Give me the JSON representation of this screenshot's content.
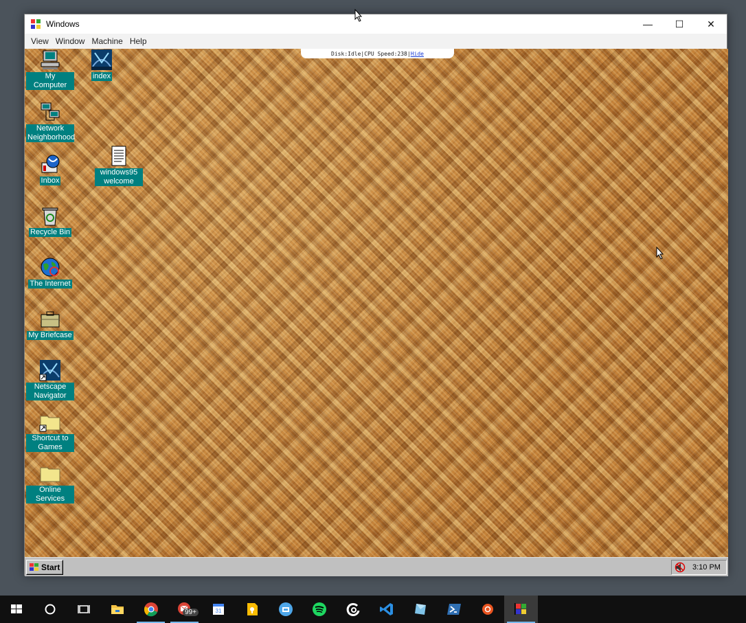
{
  "window": {
    "title": "Windows",
    "controls": {
      "minimize": "—",
      "maximize": "☐",
      "close": "✕"
    }
  },
  "menu": [
    "View",
    "Window",
    "Machine",
    "Help"
  ],
  "status": {
    "disk_label": "Disk:",
    "disk_value": "Idle",
    "separator": "|",
    "cpu_label": "CPU Speed:",
    "cpu_value": "238",
    "hide": "Hide"
  },
  "desktop_icons": [
    {
      "label": "My Computer",
      "icon": "computer-icon"
    },
    {
      "label": "index",
      "icon": "netscape-icon"
    },
    {
      "label": "Network Neighborhood",
      "icon": "network-icon"
    },
    {
      "label": "windows95 welcome",
      "icon": "text-file-icon"
    },
    {
      "label": "Inbox",
      "icon": "inbox-icon"
    },
    {
      "label": "Recycle Bin",
      "icon": "recycle-bin-icon"
    },
    {
      "label": "The Internet",
      "icon": "internet-icon"
    },
    {
      "label": "My Briefcase",
      "icon": "briefcase-icon"
    },
    {
      "label": "Netscape Navigator",
      "icon": "netscape-icon"
    },
    {
      "label": "Shortcut to Games",
      "icon": "folder-shortcut-icon"
    },
    {
      "label": "Online Services",
      "icon": "folder-icon"
    }
  ],
  "w95_taskbar": {
    "start": "Start",
    "clock": "3:10 PM"
  },
  "host_taskbar": {
    "items": [
      "windows-start-icon",
      "cortana-icon",
      "task-view-icon",
      "file-explorer-icon",
      "chrome-icon",
      "gmail-icon",
      "calendar-icon",
      "keep-icon",
      "remote-icon",
      "spotify-icon",
      "edge-icon",
      "vscode-icon",
      "app-icon",
      "powershell-icon",
      "ubuntu-icon",
      "windows95-icon"
    ],
    "gmail_badge": "99+",
    "calendar_day": "31"
  }
}
